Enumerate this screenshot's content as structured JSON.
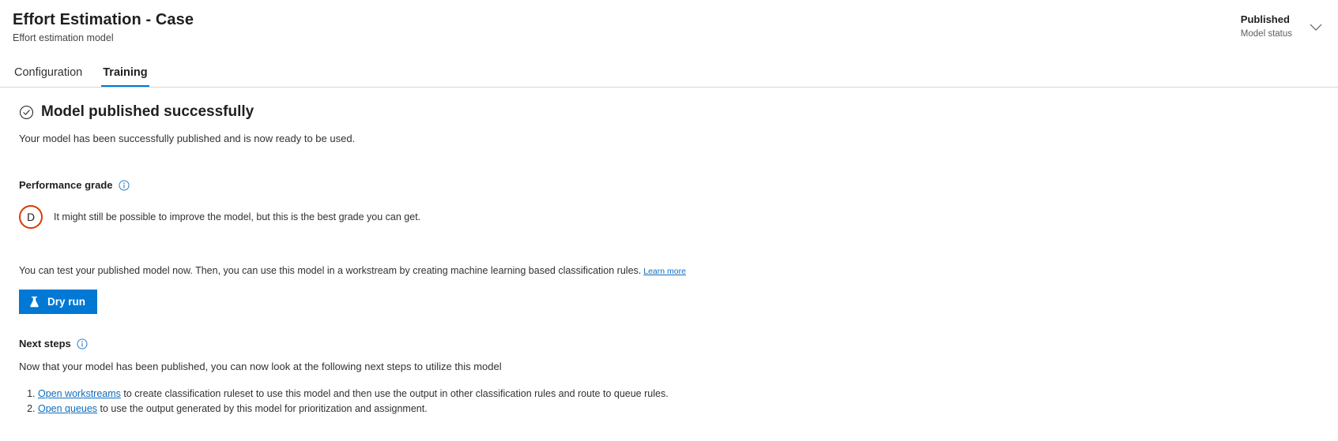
{
  "header": {
    "title": "Effort Estimation - Case",
    "subtitle": "Effort estimation model",
    "status_value": "Published",
    "status_label": "Model status",
    "chevron_icon": "chevron-down-icon"
  },
  "tabs": [
    {
      "label": "Configuration",
      "active": false
    },
    {
      "label": "Training",
      "active": true
    }
  ],
  "success": {
    "icon": "checkmark-circle-icon",
    "title": "Model published successfully",
    "description": "Your model has been successfully published and is now ready to be used."
  },
  "performance": {
    "label": "Performance grade",
    "info_icon": "info-icon",
    "grade": "D",
    "grade_color": "#d83b01",
    "grade_description": "It might still be possible to improve the model, but this is the best grade you can get."
  },
  "test": {
    "text": "You can test your published model now. Then, you can use this model in a workstream by creating machine learning based classification rules.",
    "link_label": "Learn more",
    "button_label": "Dry run",
    "button_icon": "flask-icon",
    "button_color": "#0078d4"
  },
  "next_steps": {
    "label": "Next steps",
    "info_icon": "info-icon",
    "description": "Now that your model has been published, you can now look at the following next steps to utilize this model",
    "items": [
      {
        "link_label": "Open workstreams",
        "text": " to create classification ruleset to use this model and then use the output in other classification rules and route to queue rules."
      },
      {
        "link_label": "Open queues",
        "text": " to use the output generated by this model for prioritization and assignment."
      }
    ]
  },
  "colors": {
    "accent": "#0078d4",
    "link": "#0f6cbd",
    "warning": "#d83b01"
  }
}
